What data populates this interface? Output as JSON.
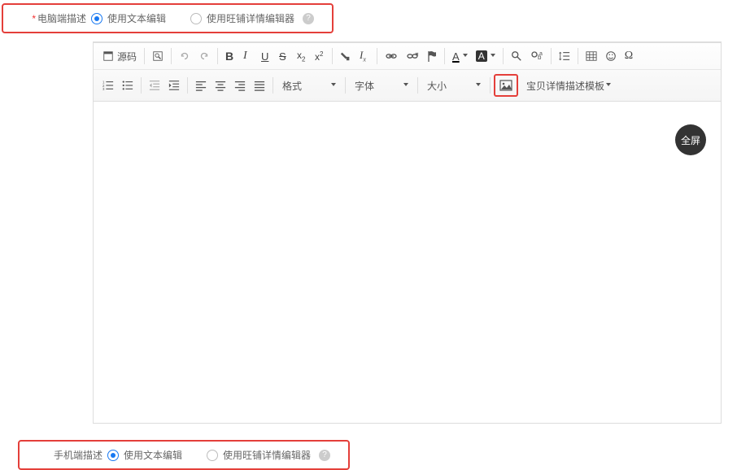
{
  "top": {
    "label": "电脑端描述",
    "required_marker": "*",
    "option1": "使用文本编辑",
    "option2": "使用旺铺详情编辑器"
  },
  "bottom": {
    "label": "手机端描述",
    "option1": "使用文本编辑",
    "option2": "使用旺铺详情编辑器"
  },
  "toolbar": {
    "source": "源码",
    "format_label": "格式",
    "font_label": "字体",
    "size_label": "大小",
    "template_link": "宝贝详情描述模板"
  },
  "editor": {
    "fullscreen": "全屏"
  }
}
